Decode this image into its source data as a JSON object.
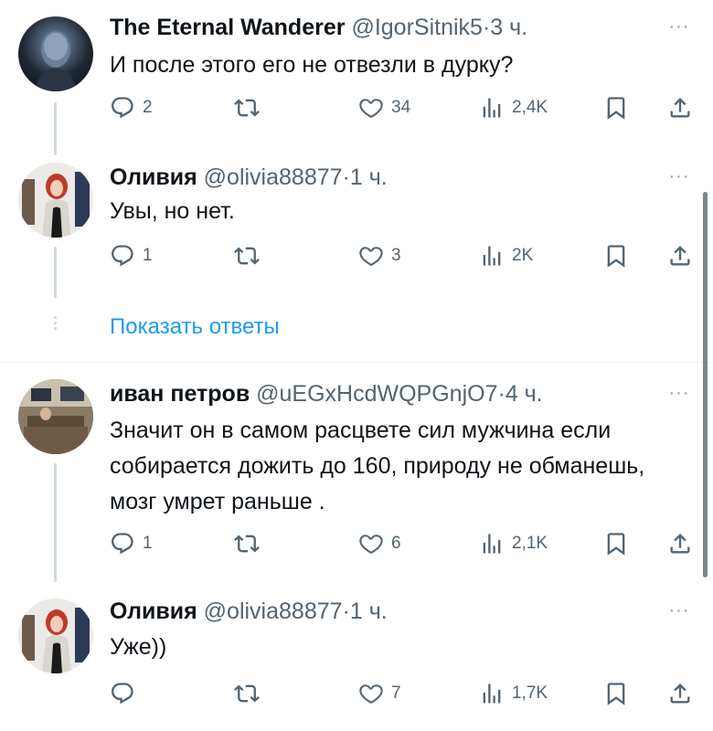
{
  "colors": {
    "accent": "#1d9bf0",
    "muted": "#536471",
    "text": "#0f1419",
    "line": "#cfd9de"
  },
  "more_label": "···",
  "show_replies": "Показать ответы",
  "tweets": [
    {
      "name": "The Eternal Wanderer",
      "handle": "@IgorSitnik5",
      "sep": "·",
      "time": "3 ч.",
      "text": "И после этого его не отвезли в дурку?",
      "replies": "2",
      "retweets": "",
      "likes": "34",
      "views": "2,4K"
    },
    {
      "name": "Оливия",
      "handle": "@olivia88877",
      "sep": "·",
      "time": "1 ч.",
      "text": "Увы, но нет.",
      "replies": "1",
      "retweets": "",
      "likes": "3",
      "views": "2K"
    },
    {
      "name": "иван петров",
      "handle": "@uEGxHcdWQPGnjO7",
      "sep": "·",
      "time": "4 ч.",
      "text": "Значит он в самом расцвете сил мужчина если собирается дожить до 160, природу не обманешь, мозг умрет раньше .",
      "replies": "1",
      "retweets": "",
      "likes": "6",
      "views": "2,1K"
    },
    {
      "name": "Оливия",
      "handle": "@olivia88877",
      "sep": "·",
      "time": "1 ч.",
      "text": "Уже))",
      "replies": "",
      "retweets": "",
      "likes": "7",
      "views": "1,7K"
    }
  ]
}
